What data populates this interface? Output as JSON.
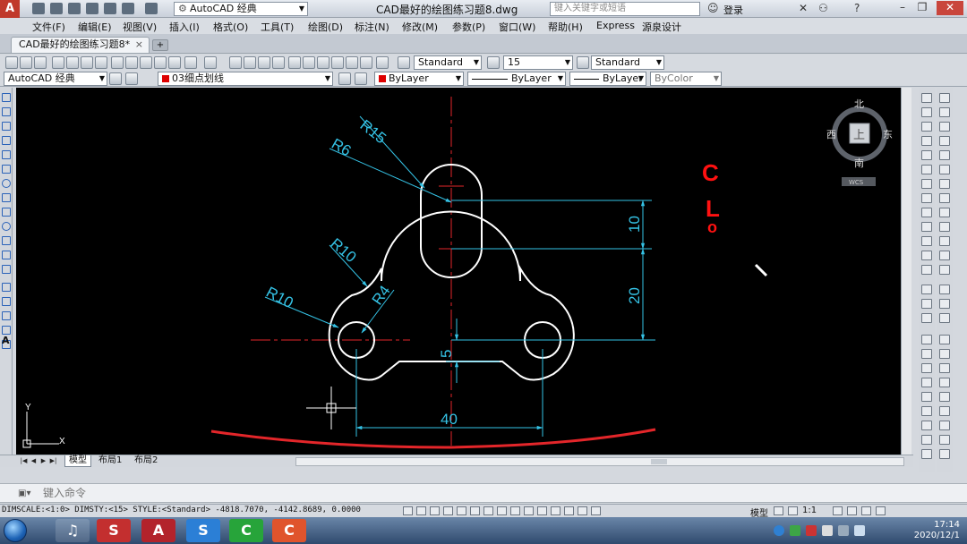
{
  "titlebar": {
    "logo": "A",
    "workspace": "AutoCAD 经典",
    "document_title": "CAD最好的绘图练习题8.dwg",
    "search_placeholder": "键入关键字或短语",
    "login": "登录",
    "help": "?"
  },
  "menu": [
    "文件(F)",
    "编辑(E)",
    "视图(V)",
    "插入(I)",
    "格式(O)",
    "工具(T)",
    "绘图(D)",
    "标注(N)",
    "修改(M)",
    "参数(P)",
    "窗口(W)",
    "帮助(H)",
    "Express",
    "源泉设计"
  ],
  "doc_tab": {
    "label": "CAD最好的绘图练习题8*",
    "close": "×"
  },
  "toolbar1": {
    "text_style": "Standard",
    "dim_style": "15",
    "table_style": "Standard"
  },
  "toolbar2": {
    "workspace": "AutoCAD 经典",
    "layer": "03细点划线",
    "color": "ByLayer",
    "linetype": "ByLayer",
    "lineweight": "ByLayer",
    "plot_style": "ByColor"
  },
  "viewcube": {
    "north": "北",
    "south": "南",
    "east": "东",
    "west": "西",
    "top": "上",
    "wcs": "WCS"
  },
  "drawing": {
    "dims": {
      "r15": "R15",
      "r6": "R6",
      "r10_upper": "R10",
      "r10_lower": "R10",
      "r4": "R4",
      "d10": "10",
      "d20": "20",
      "d5": "5",
      "d40": "40"
    },
    "ucs_y": "Y",
    "ucs_x": "X",
    "annotation": [
      "C",
      "L",
      "o"
    ],
    "colors": {
      "outline": "#ffffff",
      "dimension": "#35c3e6",
      "centerline": "#e3262a",
      "annotation": "#ff1111"
    }
  },
  "layout_tabs": [
    "模型",
    "布局1",
    "布局2"
  ],
  "command": {
    "placeholder": "键入命令"
  },
  "status": {
    "text": "DIMSCALE:<1:0> DIMSTY:<15> STYLE:<Standard>  -4818.7070, -4142.8689, 0.0000",
    "model": "模型",
    "scale": "1:1"
  },
  "clock": {
    "time": "17:14",
    "date": "2020/12/1"
  }
}
